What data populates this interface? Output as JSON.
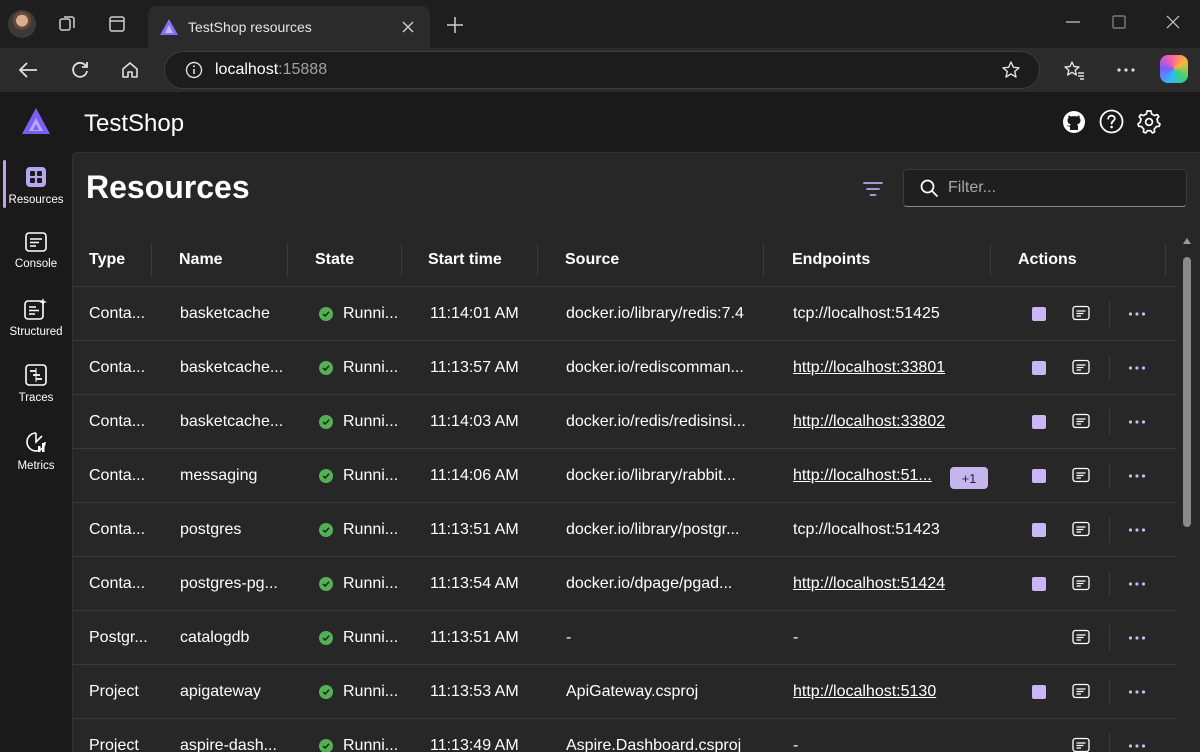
{
  "browser": {
    "tab_title": "TestShop resources",
    "url_host": "localhost",
    "url_port": ":15888"
  },
  "app": {
    "title": "TestShop"
  },
  "nav": [
    {
      "label": "Resources",
      "icon": "resources-icon",
      "active": true
    },
    {
      "label": "Console",
      "icon": "console-icon",
      "active": false
    },
    {
      "label": "Structured",
      "icon": "structured-logs-icon",
      "active": false
    },
    {
      "label": "Traces",
      "icon": "traces-icon",
      "active": false
    },
    {
      "label": "Metrics",
      "icon": "metrics-icon",
      "active": false
    }
  ],
  "page": {
    "title": "Resources",
    "filter_placeholder": "Filter..."
  },
  "columns": [
    "Type",
    "Name",
    "State",
    "Start time",
    "Source",
    "Endpoints",
    "Actions"
  ],
  "rows": [
    {
      "type": "Conta...",
      "name": "basketcache",
      "state": "Runni...",
      "start": "11:14:01 AM",
      "source": "docker.io/library/redis:7.4",
      "endpoint": "tcp://localhost:51425",
      "link": false,
      "extra": "",
      "stop": true
    },
    {
      "type": "Conta...",
      "name": "basketcache...",
      "state": "Runni...",
      "start": "11:13:57 AM",
      "source": "docker.io/rediscomman...",
      "endpoint": "http://localhost:33801",
      "link": true,
      "extra": "",
      "stop": true
    },
    {
      "type": "Conta...",
      "name": "basketcache...",
      "state": "Runni...",
      "start": "11:14:03 AM",
      "source": "docker.io/redis/redisinsi...",
      "endpoint": "http://localhost:33802",
      "link": true,
      "extra": "",
      "stop": true
    },
    {
      "type": "Conta...",
      "name": "messaging",
      "state": "Runni...",
      "start": "11:14:06 AM",
      "source": "docker.io/library/rabbit...",
      "endpoint": "http://localhost:51...",
      "link": true,
      "extra": "+1",
      "stop": true
    },
    {
      "type": "Conta...",
      "name": "postgres",
      "state": "Runni...",
      "start": "11:13:51 AM",
      "source": "docker.io/library/postgr...",
      "endpoint": "tcp://localhost:51423",
      "link": false,
      "extra": "",
      "stop": true
    },
    {
      "type": "Conta...",
      "name": "postgres-pg...",
      "state": "Runni...",
      "start": "11:13:54 AM",
      "source": "docker.io/dpage/pgad...",
      "endpoint": "http://localhost:51424",
      "link": true,
      "extra": "",
      "stop": true
    },
    {
      "type": "Postgr...",
      "name": "catalogdb",
      "state": "Runni...",
      "start": "11:13:51 AM",
      "source": "-",
      "endpoint": "-",
      "link": false,
      "extra": "",
      "stop": false
    },
    {
      "type": "Project",
      "name": "apigateway",
      "state": "Runni...",
      "start": "11:13:53 AM",
      "source": "ApiGateway.csproj",
      "endpoint": "http://localhost:5130",
      "link": true,
      "extra": "",
      "stop": true
    },
    {
      "type": "Project",
      "name": "aspire-dash...",
      "state": "Runni...",
      "start": "11:13:49 AM",
      "source": "Aspire.Dashboard.csproj",
      "endpoint": "-",
      "link": false,
      "extra": "",
      "stop": false
    }
  ],
  "colors": {
    "accent": "#c9b6f5",
    "running": "#54b054"
  }
}
